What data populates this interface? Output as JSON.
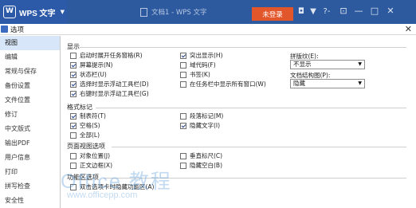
{
  "titlebar": {
    "app_name": "WPS 文字",
    "doc_title": "文档1 - WPS 文字",
    "login_label": "未登录",
    "help_label": "?-"
  },
  "dialog": {
    "title": "选项"
  },
  "sidebar": {
    "items": [
      {
        "label": "视图",
        "active": true
      },
      {
        "label": "编辑"
      },
      {
        "label": "常规与保存"
      },
      {
        "label": "备份设置"
      },
      {
        "label": "文件位置"
      },
      {
        "label": "修订"
      },
      {
        "label": "中文版式"
      },
      {
        "label": "输出PDF"
      },
      {
        "label": "用户信息"
      },
      {
        "label": "打印"
      },
      {
        "label": "拼写检查"
      },
      {
        "label": "安全性"
      }
    ]
  },
  "display": {
    "heading": "显示",
    "options": [
      {
        "label": "启动时展开任务窗格(R)",
        "checked": false
      },
      {
        "label": "屏幕提示(N)",
        "checked": true
      },
      {
        "label": "状态栏(U)",
        "checked": true
      },
      {
        "label": "选择时显示浮动工具栏(D)",
        "checked": true
      },
      {
        "label": "右键时显示浮动工具栏(G)",
        "checked": true
      },
      {
        "label": "突出显示(H)",
        "checked": true
      },
      {
        "label": "域代码(F)",
        "checked": false
      },
      {
        "label": "书签(K)",
        "checked": false
      },
      {
        "label": "在任务栏中显示所有窗口(W)",
        "checked": false
      }
    ],
    "texture_label": "拼版纹(E):",
    "texture_value": "不显示",
    "doc_map_label": "文档结构图(P):",
    "doc_map_value": "隐藏"
  },
  "format_marks": {
    "heading": "格式标记",
    "options": [
      {
        "label": "制表符(T)",
        "checked": true
      },
      {
        "label": "空格(S)",
        "checked": true
      },
      {
        "label": "全部(L)",
        "checked": false
      },
      {
        "label": "段落标记(M)",
        "checked": false
      },
      {
        "label": "隐藏文字(I)",
        "checked": true
      }
    ]
  },
  "page_view": {
    "heading": "页面视图选项",
    "options": [
      {
        "label": "对象位置(J)",
        "checked": false
      },
      {
        "label": "正文边框(X)",
        "checked": false
      },
      {
        "label": "垂直标尺(C)",
        "checked": false
      },
      {
        "label": "隐藏空白(B)",
        "checked": false
      }
    ]
  },
  "ribbon": {
    "heading": "功能区选项",
    "options": [
      {
        "label": "双击选项卡时隐藏功能区(A)",
        "checked": false
      }
    ]
  },
  "watermark": {
    "text": "Office 教程",
    "url": "www.officepp.com"
  }
}
